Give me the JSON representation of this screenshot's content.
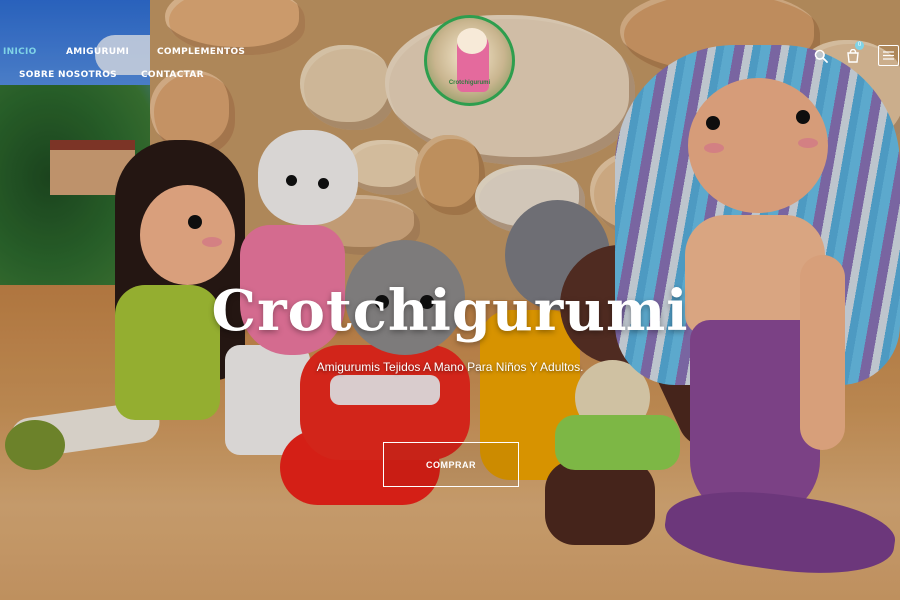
{
  "nav": {
    "items": [
      {
        "label": "INICIO",
        "active": true
      },
      {
        "label": "AMIGURUMI",
        "active": false
      },
      {
        "label": "COMPLEMENTOS",
        "active": false
      },
      {
        "label": "SOBRE NOSOTROS",
        "active": false
      },
      {
        "label": "CONTACTAR",
        "active": false
      }
    ]
  },
  "header": {
    "logo_text": "Crotchigurumi",
    "icons": [
      "search-icon",
      "cart-icon",
      "hamburger-menu-icon"
    ],
    "cart_count": "0"
  },
  "hero": {
    "title": "Crotchigurumi",
    "subtitle": "Amigurumis Tejidos A Mano Para Niños Y Adultos.",
    "cta_label": "COMPRAR"
  },
  "colors": {
    "accent": "#7fd3e6",
    "text": "#ffffff",
    "logo_ring": "#2e9e4e"
  }
}
